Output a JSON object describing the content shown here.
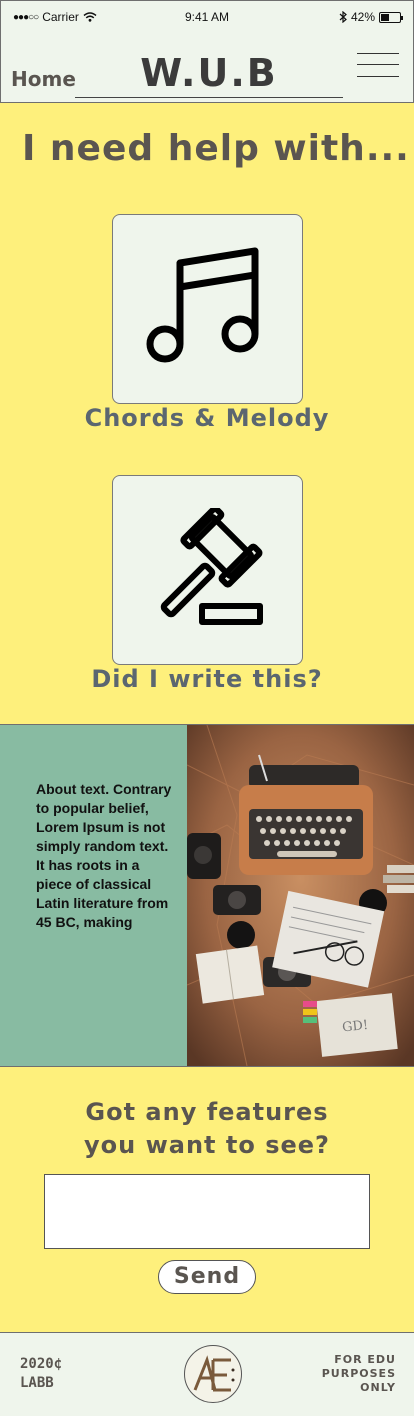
{
  "status_bar": {
    "carrier": "Carrier",
    "time": "9:41 AM",
    "battery_percent": "42%",
    "battery_level": 0.42,
    "icons": [
      "signal-dots-icon",
      "wifi-icon",
      "bluetooth-icon",
      "battery-icon"
    ]
  },
  "header": {
    "home_label": "Home",
    "title": "W.U.B",
    "menu_icon": "hamburger-menu-icon"
  },
  "help": {
    "heading": "I need help with...",
    "options": [
      {
        "label": "Chords & Melody",
        "icon": "music-note-icon"
      },
      {
        "label": "Did I write this?",
        "icon": "gavel-icon"
      }
    ]
  },
  "about": {
    "text": "About text. Contrary to popular belief, Lorem Ipsum is not simply random text. It has roots in a piece of classical Latin literature from 45 BC, making",
    "image": "typewriter-desk-photo"
  },
  "features": {
    "heading_line1": "Got any features",
    "heading_line2": "you want to see?",
    "input_value": "",
    "send_label": "Send"
  },
  "footer": {
    "left_line1": "2020¢",
    "left_line2": "LABB",
    "logo_text": "Æ",
    "right_line1": "FOR EDU",
    "right_line2": "PURPOSES",
    "right_line3": "ONLY"
  },
  "colors": {
    "background": "#fef07c",
    "panel": "#eff5ec",
    "about_panel": "#88bba2",
    "text": "#5a5550",
    "label": "#5b6670"
  }
}
